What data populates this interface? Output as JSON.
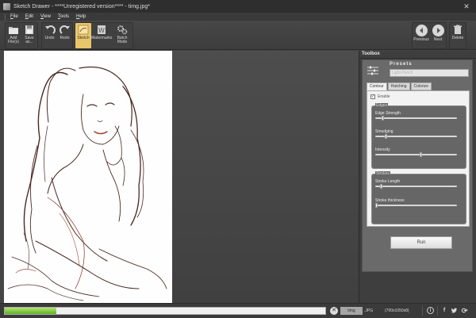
{
  "window": {
    "title": "Sketch Drawer - ****Unregistered version**** - timg.jpg*",
    "close_glyph": "✕"
  },
  "menu": [
    "File",
    "Edit",
    "View",
    "Tools",
    "Help"
  ],
  "toolbar": {
    "add_files": "Add\nFile(s)",
    "save_as": "Save\nas...",
    "undo": "Undo",
    "redo": "Redo",
    "sketch": "Sketch",
    "watermarks": "Watermarks",
    "batch_mode": "Batch\nMode",
    "previous": "Previous",
    "next": "Next",
    "delete": "Delete"
  },
  "toolbox": {
    "title": "Toolbox",
    "presets_label": "Presets",
    "presets_value": "Light Pencil",
    "tabs": [
      "Contour",
      "Hatching",
      "Colorize"
    ],
    "active_tab": "Contour",
    "enable_label": "Enable",
    "enable_checked": true,
    "edges_title": "Edges",
    "strokes_title": "Strokes",
    "sliders": {
      "edge_strength": {
        "label": "Edge Strength",
        "value": 0.08
      },
      "smudging": {
        "label": "Smudging",
        "value": 0.12
      },
      "intensity": {
        "label": "Intensity",
        "value": 0.57
      },
      "stroke_length": {
        "label": "Stroke Length",
        "value": 0.06
      },
      "stroke_thickness": {
        "label": "Stroke thickness",
        "value": 0.0
      }
    },
    "run_label": "Run"
  },
  "status": {
    "progress": 0.16,
    "filename": "timg",
    "extension": ".JPG",
    "dimensions": "(700x1050x8)",
    "stop_glyph": "✕",
    "info_glyph": "i",
    "facebook_glyph": "f"
  },
  "colors": {
    "accent": "#e9c66a",
    "progress": "#5bb12c"
  },
  "icons": {
    "app": "sketch-drawer-icon",
    "add_files": "folder-icon",
    "save": "floppy-icon",
    "undo": "undo-icon",
    "redo": "redo-icon",
    "sketch": "sketch-icon",
    "watermarks": "watermark-icon",
    "batch": "gears-icon",
    "previous": "arrow-left-icon",
    "next": "arrow-right-icon",
    "delete": "trash-icon",
    "presets": "sliders-icon",
    "twitter": "twitter-icon"
  }
}
